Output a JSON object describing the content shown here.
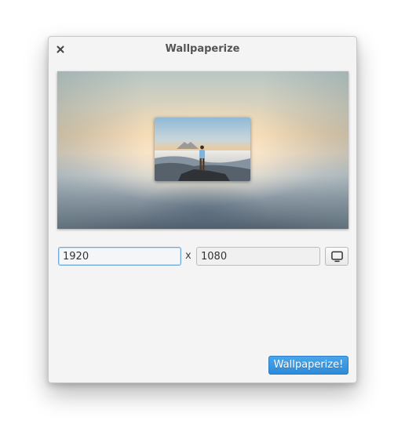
{
  "window": {
    "title": "Wallpaperize"
  },
  "icons": {
    "close": "close-icon",
    "display": "monitor-icon"
  },
  "resolution": {
    "width_value": "1920",
    "separator": "x",
    "height_value": "1080"
  },
  "actions": {
    "primary_label": "Wallpaperize!"
  },
  "colors": {
    "accent": "#3498db",
    "window_bg": "#f4f4f4",
    "focus_border": "#6fa9dd"
  }
}
